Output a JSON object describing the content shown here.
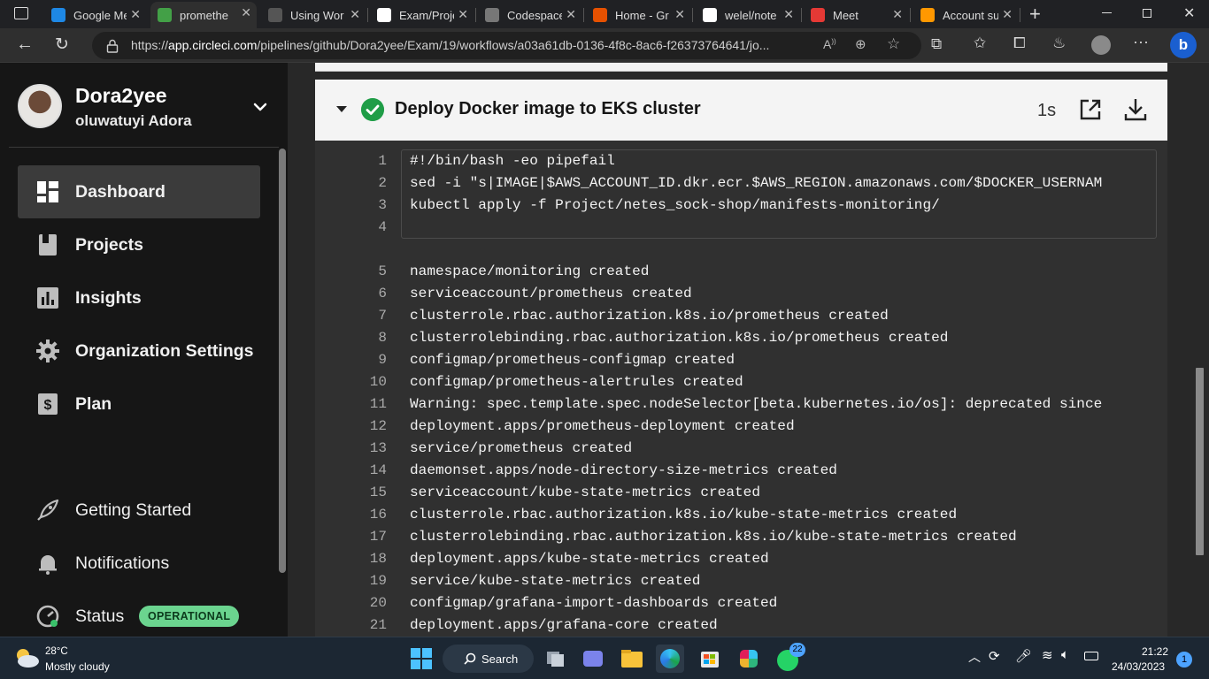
{
  "browser": {
    "tabs": [
      {
        "title": "Google Me",
        "fav_color": "#1e88e5"
      },
      {
        "title": "promethe",
        "fav_color": "#43a047",
        "active": true
      },
      {
        "title": "Using Wor",
        "fav_color": "#555555"
      },
      {
        "title": "Exam/Proje",
        "fav_color": "#ffffff"
      },
      {
        "title": "Codespace",
        "fav_color": "#777777"
      },
      {
        "title": "Home - Gr",
        "fav_color": "#e65100"
      },
      {
        "title": "welel/note",
        "fav_color": "#ffffff"
      },
      {
        "title": "Meet",
        "fav_color": "#e53935"
      },
      {
        "title": "Account su",
        "fav_color": "#ff9800"
      }
    ],
    "url_prefix": "https://",
    "url_host": "app.circleci.com",
    "url_path": "/pipelines/github/Dora2yee/Exam/19/workflows/a03a61db-0136-4f8c-8ac6-f26373764641/jo..."
  },
  "sidebar": {
    "org_name": "Dora2yee",
    "user_name": "oluwatuyi Adora",
    "items": [
      {
        "label": "Dashboard",
        "icon": "dashboard-icon"
      },
      {
        "label": "Projects",
        "icon": "projects-icon"
      },
      {
        "label": "Insights",
        "icon": "insights-icon"
      },
      {
        "label": "Organization Settings",
        "icon": "gear-icon"
      },
      {
        "label": "Plan",
        "icon": "dollar-icon"
      }
    ],
    "bottom_items": [
      {
        "label": "Getting Started",
        "icon": "rocket-icon"
      },
      {
        "label": "Notifications",
        "icon": "bell-icon"
      },
      {
        "label": "Status",
        "icon": "status-icon"
      }
    ],
    "status_badge": "OPERATIONAL"
  },
  "step": {
    "title": "Deploy Docker image to EKS cluster",
    "duration": "1s",
    "status_color": "#1f9d47"
  },
  "console": {
    "command_lines": [
      {
        "n": "1",
        "text": "#!/bin/bash -eo pipefail"
      },
      {
        "n": "2",
        "text": "sed -i \"s|IMAGE|$AWS_ACCOUNT_ID.dkr.ecr.$AWS_REGION.amazonaws.com/$DOCKER_USERNAM"
      },
      {
        "n": "3",
        "text": "kubectl apply -f Project/netes_sock-shop/manifests-monitoring/"
      },
      {
        "n": "4",
        "text": ""
      }
    ],
    "output_lines": [
      {
        "n": "5",
        "text": "namespace/monitoring created"
      },
      {
        "n": "6",
        "text": "serviceaccount/prometheus created"
      },
      {
        "n": "7",
        "text": "clusterrole.rbac.authorization.k8s.io/prometheus created"
      },
      {
        "n": "8",
        "text": "clusterrolebinding.rbac.authorization.k8s.io/prometheus created"
      },
      {
        "n": "9",
        "text": "configmap/prometheus-configmap created"
      },
      {
        "n": "10",
        "text": "configmap/prometheus-alertrules created"
      },
      {
        "n": "11",
        "text": "Warning: spec.template.spec.nodeSelector[beta.kubernetes.io/os]: deprecated since"
      },
      {
        "n": "12",
        "text": "deployment.apps/prometheus-deployment created"
      },
      {
        "n": "13",
        "text": "service/prometheus created"
      },
      {
        "n": "14",
        "text": "daemonset.apps/node-directory-size-metrics created"
      },
      {
        "n": "15",
        "text": "serviceaccount/kube-state-metrics created"
      },
      {
        "n": "16",
        "text": "clusterrole.rbac.authorization.k8s.io/kube-state-metrics created"
      },
      {
        "n": "17",
        "text": "clusterrolebinding.rbac.authorization.k8s.io/kube-state-metrics created"
      },
      {
        "n": "18",
        "text": "deployment.apps/kube-state-metrics created"
      },
      {
        "n": "19",
        "text": "service/kube-state-metrics created"
      },
      {
        "n": "20",
        "text": "configmap/grafana-import-dashboards created"
      },
      {
        "n": "21",
        "text": "deployment.apps/grafana-core created"
      }
    ]
  },
  "taskbar": {
    "weather_temp": "28°C",
    "weather_desc": "Mostly cloudy",
    "search_label": "Search",
    "whatsapp_badge": "22",
    "time": "21:22",
    "date": "24/03/2023",
    "notification_count": "1"
  }
}
